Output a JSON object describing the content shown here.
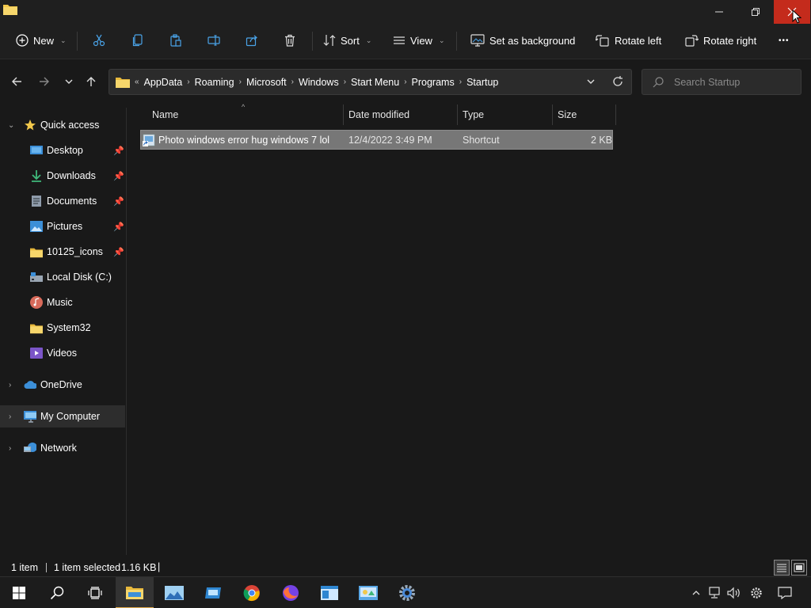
{
  "window": {
    "minimize_label": "Minimize",
    "maximize_label": "Restore",
    "close_label": "Close"
  },
  "toolbar": {
    "new_label": "New",
    "sort_label": "Sort",
    "view_label": "View",
    "set_background_label": "Set as background",
    "rotate_left_label": "Rotate left",
    "rotate_right_label": "Rotate right",
    "more_label": "•••"
  },
  "address": {
    "overflow": "«",
    "crumbs": [
      "AppData",
      "Roaming",
      "Microsoft",
      "Windows",
      "Start Menu",
      "Programs",
      "Startup"
    ]
  },
  "search": {
    "placeholder": "Search Startup"
  },
  "sidebar": {
    "quick_access": "Quick access",
    "items": [
      {
        "label": "Desktop",
        "icon": "desktop-icon",
        "pinned": true
      },
      {
        "label": "Downloads",
        "icon": "download-icon",
        "pinned": true
      },
      {
        "label": "Documents",
        "icon": "document-icon",
        "pinned": true
      },
      {
        "label": "Pictures",
        "icon": "pictures-icon",
        "pinned": true
      },
      {
        "label": "10125_icons",
        "icon": "folder-icon",
        "pinned": true
      },
      {
        "label": "Local Disk (C:)",
        "icon": "drive-icon",
        "pinned": false
      },
      {
        "label": "Music",
        "icon": "music-icon",
        "pinned": false
      },
      {
        "label": "System32",
        "icon": "folder-icon",
        "pinned": false
      },
      {
        "label": "Videos",
        "icon": "videos-icon",
        "pinned": false
      }
    ],
    "onedrive": "OneDrive",
    "my_computer": "My Computer",
    "network": "Network"
  },
  "columns": {
    "name": "Name",
    "date": "Date modified",
    "type": "Type",
    "size": "Size"
  },
  "files": [
    {
      "name": "Photo windows error hug windows 7 lol",
      "date": "12/4/2022 3:49 PM",
      "type": "Shortcut",
      "size": "2 KB",
      "selected": true
    }
  ],
  "status": {
    "count": "1 item",
    "selected": "1 item selected",
    "size": "1.16 KB",
    "cursor": "|"
  },
  "colors": {
    "accent_close": "#c42b1c",
    "selection": "#777777",
    "folder_yellow": "#f2c84b"
  }
}
